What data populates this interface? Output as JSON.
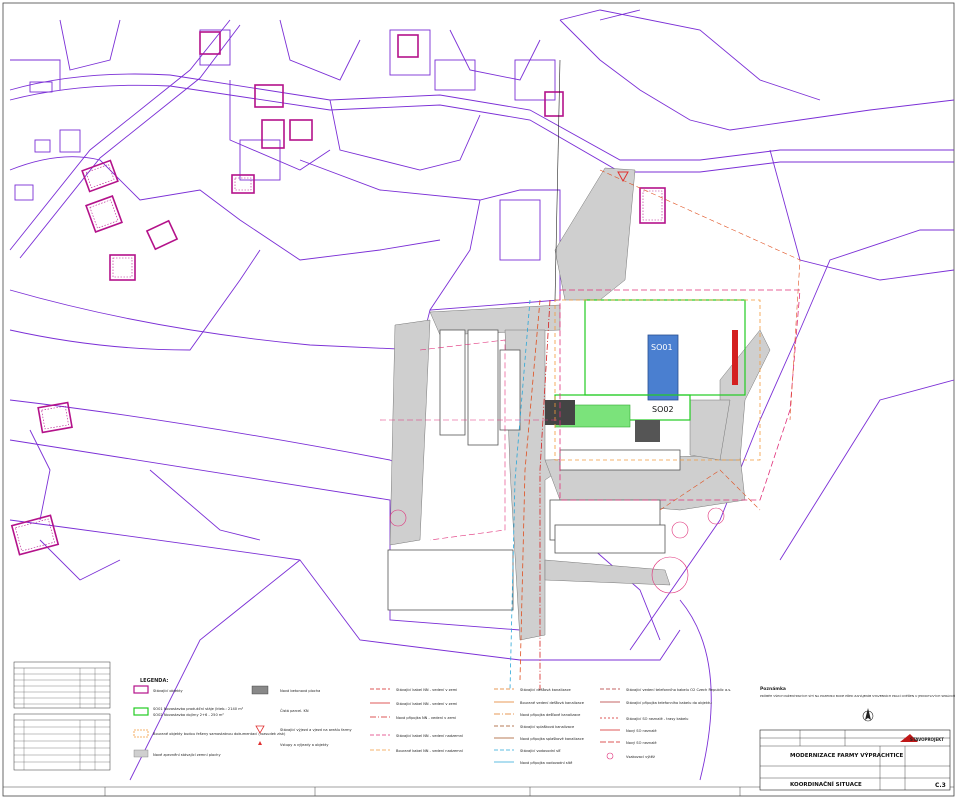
{
  "buildings": {
    "so01": "SO01",
    "so02": "SO02"
  },
  "legend": {
    "title": "LEGENDA:",
    "col1": [
      "Stávající objekty",
      "SO01 Novostavba produkční stáje (kteb.: 2140 m²",
      "SO02 Novostavba dojírny 2+6 - 250 m²",
      "Bourané objekty budou řešeny samostatnou dokumentací (rozsudek zisk)",
      "Nové zpevnění stávající zemní plochy"
    ],
    "col2": [
      "Nová betonová plocha",
      "Čistá parcel. KN",
      "Stávající výjezd a vjezd na areálu farmy",
      "Vstupy a výjezdy a objekty"
    ],
    "col3": [
      "Stávající kabel NN - vedení v zemi",
      "Stávající kabel NN - vedení v zemi",
      "Nová přípojka NN - vedení v zemi",
      "Stávající kabel NN - vedení nadzemní",
      "Bourané kabel NN - vedení nadzemní"
    ],
    "col4": [
      "Stávající dešťová kanalizace",
      "Bourané vedení dešťová kanalizace",
      "Nová přípojka dešťové kanalizace",
      "Stávající splašková kanalizace",
      "Nová přípojka splaškové kanalizace",
      "Stávající vodovodní síť",
      "Nová přípojka vodovodní sítě"
    ],
    "col5": [
      "Stávající vedení telefonního kabelu O2 Czech Republic a.s.",
      "Stávající přípojka telefonního kabelu do objektu",
      "Stávající SO neznalé - trasy kabelu",
      "Nový SO neznalé",
      "Nový SO neznalé",
      "Vsakovací výtěž"
    ]
  },
  "note": {
    "title": "Poznámka",
    "text": "PRŮBĚH VŠECH INŽENÝRSKÝCH SÍTÍ NA POZEMKU BUDE PŘED ZAHÁJENÍM STAVEBNÍCH PRACÍ OVĚŘEN U JEDNOTLIVÝCH SPRÁVCŮ"
  },
  "title_block": {
    "project": "MODERNIZACE FARMY VÝPRACHTICE",
    "drawing": "KOORDINAČNÍ SITUACE",
    "company": "STAVOPROJEKT",
    "sheet": "C.3"
  }
}
